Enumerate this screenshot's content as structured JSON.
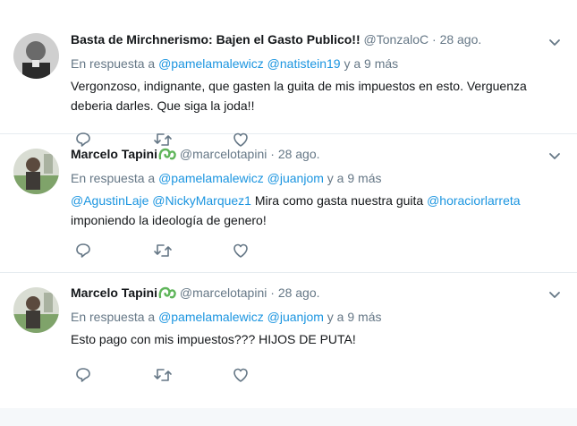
{
  "tweets": [
    {
      "name": "Basta de Mirchnerismo: Bajen el Gasto Publico!!",
      "handle": "@TonzaloC",
      "time": "28 ago.",
      "reply_prefix": "En respuesta a",
      "reply_users": [
        "@pamelamalewicz",
        "@natistein19"
      ],
      "reply_suffix": "y a 9 más",
      "text": "Vergonzoso, indignante, que gasten la guita de mis impuestos en esto. Verguenza deberia darles. Que siga la joda!!",
      "verified": false
    },
    {
      "name": "Marcelo Tapini",
      "handle": "@marcelotapini",
      "time": "28 ago.",
      "reply_prefix": "En respuesta a",
      "reply_users": [
        "@pamelamalewicz",
        "@juanjom"
      ],
      "reply_suffix": "y a 9 más",
      "text_mentions": [
        "@AgustinLaje",
        "@NickyMarquez1"
      ],
      "text_middle": "Mira como gasta nuestra guita",
      "text_mention_end": "@horaciorlarreta",
      "text_tail": "imponiendo la ideología de genero!",
      "verified": true
    },
    {
      "name": "Marcelo Tapini",
      "handle": "@marcelotapini",
      "time": "28 ago.",
      "reply_prefix": "En respuesta a",
      "reply_users": [
        "@pamelamalewicz",
        "@juanjom"
      ],
      "reply_suffix": "y a 9 más",
      "text": "Esto pago con mis impuestos??? HIJOS DE PUTA!",
      "verified": true
    }
  ],
  "separator": "·",
  "colors": {
    "link": "#1b95e0",
    "muted": "#657786",
    "text": "#14171a",
    "verified_badge": "#5fb55a"
  },
  "icons": [
    "avatar",
    "verified-badge-icon",
    "chevron-down-icon",
    "reply-icon",
    "retweet-icon",
    "like-icon"
  ]
}
